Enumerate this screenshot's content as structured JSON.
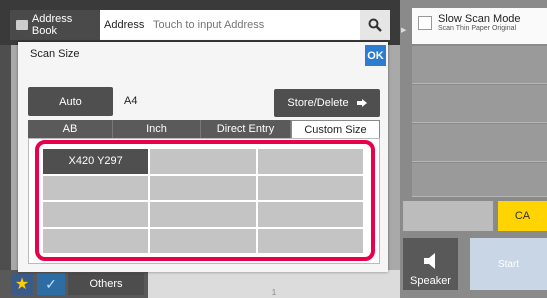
{
  "header": {
    "address_book_label": "Address Book",
    "address_label": "Address",
    "address_placeholder": "Touch to input Address",
    "search_icon": "search-icon"
  },
  "right_panel": {
    "slow_scan_title": "Slow Scan Mode",
    "slow_scan_subtitle": "Scan Thin Paper Original",
    "ca_label": "CA",
    "speaker_label": "Speaker",
    "start_label": "Start"
  },
  "dialog": {
    "title": "Scan Size",
    "ok_label": "OK",
    "auto_label": "Auto",
    "current_size": "A4",
    "store_delete_label": "Store/Delete",
    "tabs": [
      "AB",
      "Inch",
      "Direct Entry",
      "Custom Size"
    ],
    "active_tab": "Custom Size",
    "custom_sizes": [
      "X420 Y297",
      "",
      "",
      "",
      "",
      "",
      "",
      "",
      "",
      "",
      "",
      ""
    ]
  },
  "bottom_bar": {
    "others_label": "Others",
    "page_number": "1"
  },
  "colors": {
    "ok_blue": "#2b7dd0",
    "ca_yellow": "#ffd400",
    "highlight_red": "#e8004a"
  }
}
